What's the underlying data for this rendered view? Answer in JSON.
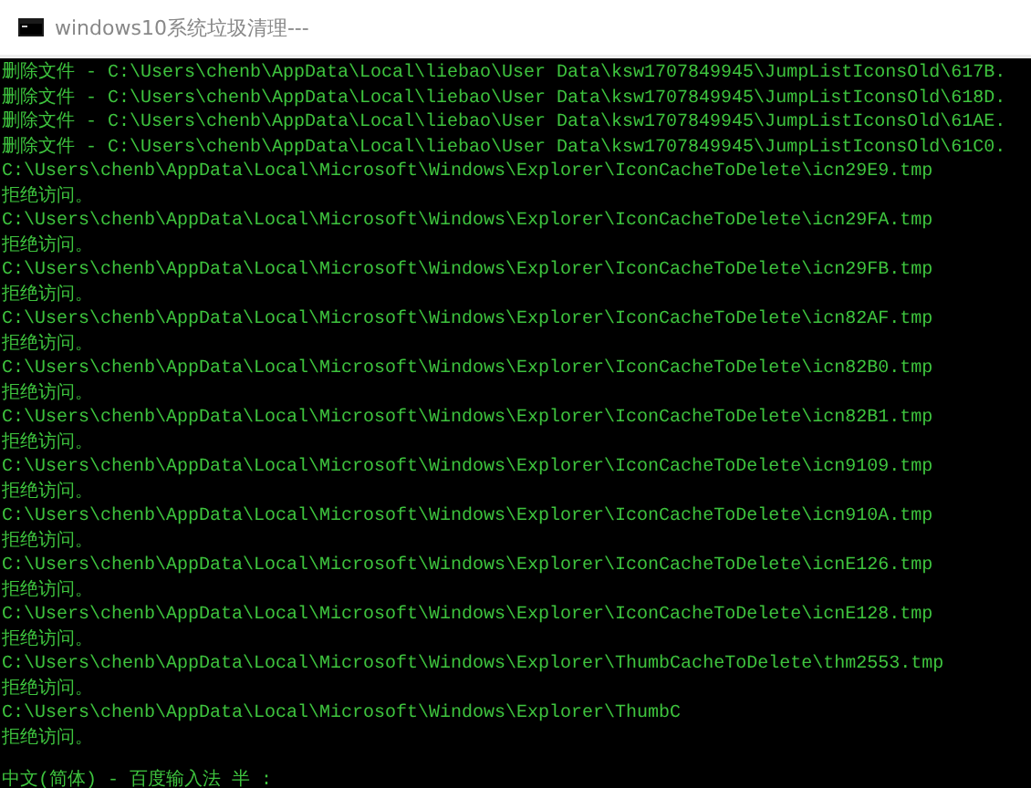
{
  "window": {
    "title": "windows10系统垃圾清理---"
  },
  "console": {
    "delete_lines": [
      {
        "prefix": "删除文件",
        "path": " - C:\\Users\\chenb\\AppData\\Local\\liebao\\User Data\\ksw1707849945\\JumpListIconsOld\\617B."
      },
      {
        "prefix": "删除文件",
        "path": " - C:\\Users\\chenb\\AppData\\Local\\liebao\\User Data\\ksw1707849945\\JumpListIconsOld\\618D."
      },
      {
        "prefix": "删除文件",
        "path": " - C:\\Users\\chenb\\AppData\\Local\\liebao\\User Data\\ksw1707849945\\JumpListIconsOld\\61AE."
      },
      {
        "prefix": "删除文件",
        "path": " - C:\\Users\\chenb\\AppData\\Local\\liebao\\User Data\\ksw1707849945\\JumpListIconsOld\\61C0."
      }
    ],
    "entries": [
      {
        "path": "C:\\Users\\chenb\\AppData\\Local\\Microsoft\\Windows\\Explorer\\IconCacheToDelete\\icn29E9.tmp",
        "message": "拒绝访问。"
      },
      {
        "path": "C:\\Users\\chenb\\AppData\\Local\\Microsoft\\Windows\\Explorer\\IconCacheToDelete\\icn29FA.tmp",
        "message": "拒绝访问。"
      },
      {
        "path": "C:\\Users\\chenb\\AppData\\Local\\Microsoft\\Windows\\Explorer\\IconCacheToDelete\\icn29FB.tmp",
        "message": "拒绝访问。"
      },
      {
        "path": "C:\\Users\\chenb\\AppData\\Local\\Microsoft\\Windows\\Explorer\\IconCacheToDelete\\icn82AF.tmp",
        "message": "拒绝访问。"
      },
      {
        "path": "C:\\Users\\chenb\\AppData\\Local\\Microsoft\\Windows\\Explorer\\IconCacheToDelete\\icn82B0.tmp",
        "message": "拒绝访问。"
      },
      {
        "path": "C:\\Users\\chenb\\AppData\\Local\\Microsoft\\Windows\\Explorer\\IconCacheToDelete\\icn82B1.tmp",
        "message": "拒绝访问。"
      },
      {
        "path": "C:\\Users\\chenb\\AppData\\Local\\Microsoft\\Windows\\Explorer\\IconCacheToDelete\\icn9109.tmp",
        "message": "拒绝访问。"
      },
      {
        "path": "C:\\Users\\chenb\\AppData\\Local\\Microsoft\\Windows\\Explorer\\IconCacheToDelete\\icn910A.tmp",
        "message": "拒绝访问。"
      },
      {
        "path": "C:\\Users\\chenb\\AppData\\Local\\Microsoft\\Windows\\Explorer\\IconCacheToDelete\\icnE126.tmp",
        "message": "拒绝访问。"
      },
      {
        "path": "C:\\Users\\chenb\\AppData\\Local\\Microsoft\\Windows\\Explorer\\IconCacheToDelete\\icnE128.tmp",
        "message": "拒绝访问。"
      },
      {
        "path": "C:\\Users\\chenb\\AppData\\Local\\Microsoft\\Windows\\Explorer\\ThumbCacheToDelete\\thm2553.tmp",
        "message": "拒绝访问。"
      },
      {
        "path": "C:\\Users\\chenb\\AppData\\Local\\Microsoft\\Windows\\Explorer\\ThumbC",
        "message": "拒绝访问。"
      }
    ]
  },
  "ime_status": "中文(简体) - 百度输入法 半 :"
}
